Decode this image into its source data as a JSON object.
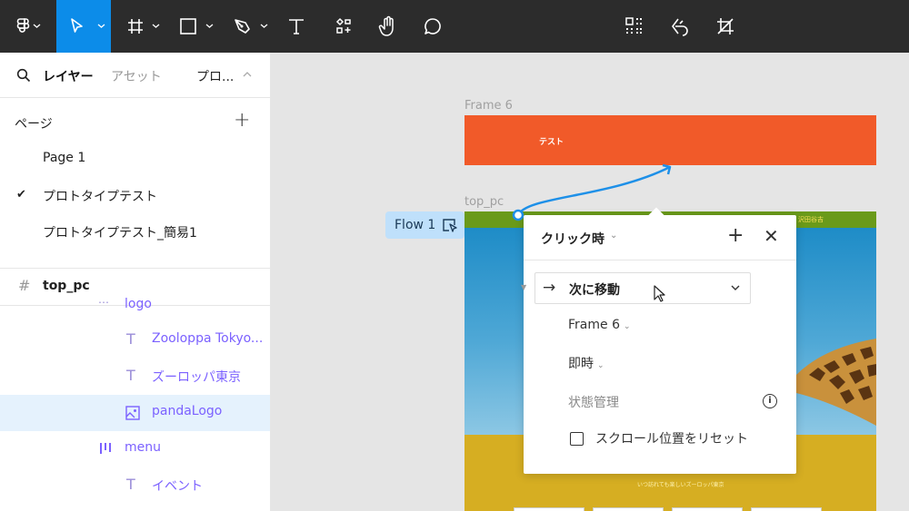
{
  "toolbar": {
    "tools": [
      {
        "icon": "figma-menu-icon"
      },
      {
        "icon": "move-tool-icon",
        "active": true
      },
      {
        "icon": "frame-tool-icon"
      },
      {
        "icon": "shape-tool-icon"
      },
      {
        "icon": "pen-tool-icon"
      },
      {
        "icon": "text-tool-icon"
      },
      {
        "icon": "components-icon"
      },
      {
        "icon": "hand-tool-icon"
      },
      {
        "icon": "comment-tool-icon"
      },
      {
        "icon": "grid-select-icon"
      },
      {
        "icon": "link-icon"
      },
      {
        "icon": "crop-icon"
      }
    ],
    "accent": "#0c8ce9",
    "background": "#2c2c2c"
  },
  "left_panel": {
    "tabs": {
      "layers": "レイヤー",
      "assets": "アセット",
      "prototype": "プロ..."
    },
    "pages_header": "ページ",
    "pages": [
      {
        "label": "Page 1",
        "current": false
      },
      {
        "label": "プロトタイプテスト",
        "current": true
      },
      {
        "label": "プロトタイプテスト_簡易1",
        "current": false
      }
    ],
    "frame": {
      "name": "top_pc"
    },
    "layers": [
      {
        "label": "logo",
        "icon": "group-icon"
      },
      {
        "label": "Zooloppa Tokyo...",
        "icon": "text-layer-icon"
      },
      {
        "label": "ズーロッパ東京",
        "icon": "text-layer-icon"
      },
      {
        "label": "pandaLogo",
        "icon": "image-layer-icon",
        "selected": true
      },
      {
        "label": "menu",
        "icon": "auto-layout-icon"
      },
      {
        "label": "イベント",
        "icon": "text-layer-icon"
      }
    ]
  },
  "canvas": {
    "frame6_label": "Frame 6",
    "frame6_text": "テスト",
    "frame6_color": "#f15a29",
    "toppc_label": "top_pc",
    "toppc_band_text": "沢田谷吉",
    "toppc_yellow_text": "いつ訪れても楽しいズーロッパ東京",
    "flow_label": "Flow 1",
    "connector_color": "#1e90e8"
  },
  "interaction": {
    "trigger": "クリック時",
    "action": "次に移動",
    "destination": "Frame 6",
    "animation": "即時",
    "state_label": "状態管理",
    "reset_scroll_label": "スクロール位置をリセット",
    "reset_scroll_checked": false
  }
}
